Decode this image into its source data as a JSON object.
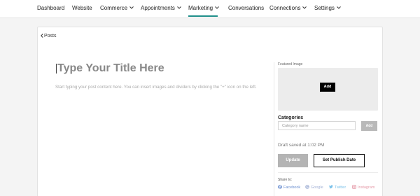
{
  "nav": {
    "items": [
      {
        "label": "Dashboard",
        "dropdown": false
      },
      {
        "label": "Website",
        "dropdown": false
      },
      {
        "label": "Commerce",
        "dropdown": true
      },
      {
        "label": "Appointments",
        "dropdown": true
      },
      {
        "label": "Marketing",
        "dropdown": true,
        "active": true
      },
      {
        "label": "Conversations",
        "dropdown": false
      },
      {
        "label": "Connections",
        "dropdown": true
      },
      {
        "label": "Settings",
        "dropdown": true
      }
    ],
    "active_color": "#1f8f8a"
  },
  "editor": {
    "back_label": "Posts",
    "title_placeholder": "Type Your Title Here",
    "body_placeholder": "Start typing your post content here. You can insert images and dividers by clicking the \"+\" icon on the left."
  },
  "sidebar": {
    "featured_image_label": "Featured Image",
    "add_image_label": "Add",
    "categories_label": "Categories",
    "category_placeholder": "Category name",
    "category_add_label": "Add",
    "draft_status": "Draft saved at 1:02 PM",
    "update_label": "Update",
    "publish_date_label": "Set Publish Date",
    "share_label": "Share to:",
    "share_targets": [
      {
        "label": "Facebook",
        "icon": "facebook-icon",
        "color": "#6b8fd0"
      },
      {
        "label": "Google",
        "icon": "google-icon",
        "color": "#a3b2d6"
      },
      {
        "label": "Twitter",
        "icon": "twitter-icon",
        "color": "#7cc2ea"
      },
      {
        "label": "Instagram",
        "icon": "instagram-icon",
        "color": "#e59aa8"
      }
    ]
  }
}
